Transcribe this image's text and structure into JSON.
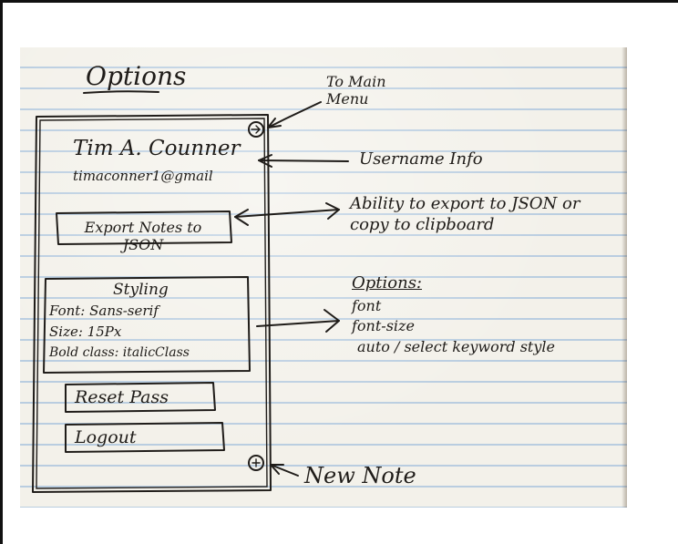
{
  "sketch": {
    "title": "Options",
    "user_name": "Tim A. Counner",
    "user_email": "timaconner1@gmail",
    "export_button": "Export Notes to JSON",
    "styling": {
      "heading": "Styling",
      "font_line": "Font: Sans-serif",
      "size_line": "Size: 15Px",
      "bold_line": "Bold class: italicClass"
    },
    "reset_button": "Reset Pass",
    "logout_button": "Logout",
    "menu_icon": "arrow-circle-icon",
    "new_note_icon": "plus-circle-icon"
  },
  "annotations": {
    "to_main_menu": "To Main Menu",
    "username_info": "Username Info",
    "export_note": "Ability to export to JSON or copy to clipboard",
    "options_heading": "Options:",
    "option_items": [
      "font",
      "font-size",
      "auto / select keyword style"
    ],
    "new_note": "New Note"
  }
}
